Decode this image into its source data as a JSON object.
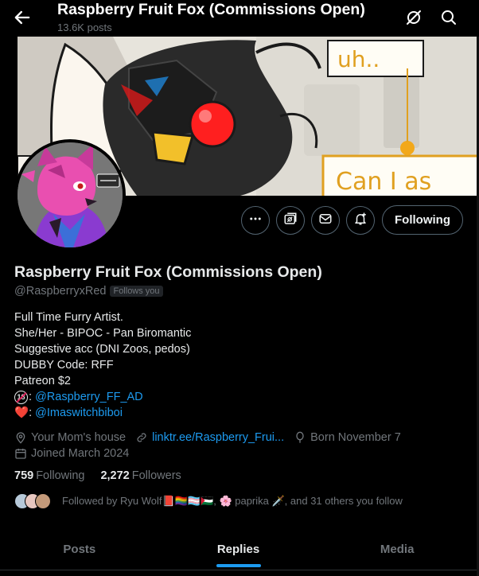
{
  "header": {
    "title": "Raspberry Fruit Fox (Commissions Open)",
    "post_count": "13.6K posts",
    "back_icon": "arrow-left-icon",
    "icons": [
      "grok-icon",
      "search-icon"
    ]
  },
  "banner": {
    "bubble_1": "uh..",
    "bubble_2": "Can I as"
  },
  "actions": {
    "icons": [
      "more-icon",
      "grok-profile-icon",
      "message-icon",
      "notifications-icon"
    ],
    "follow_label": "Following"
  },
  "profile": {
    "name": "Raspberry Fruit Fox (Commissions Open)",
    "handle": "@RaspberryxRed",
    "follows_you": "Follows you",
    "bio": {
      "line1": "Full Time Furry Artist.",
      "line2": "She/Her - BIPOC - Pan Biromantic",
      "line3": "Suggestive acc (DNI Zoos, pedos)",
      "line4": "DUBBY Code: RFF",
      "line5": "Patreon $2",
      "badge18": "18",
      "line6_sep": ": ",
      "line6_link": "@Raspberry_FF_AD",
      "line7_emoji": "❤️",
      "line7_sep": ": ",
      "line7_link": "@Imaswitchbiboi"
    },
    "location": "Your Mom's house",
    "website": "linktr.ee/Raspberry_Frui...",
    "birthday": "Born November 7",
    "joined": "Joined March 2024",
    "following_count": "759",
    "following_label": "Following",
    "followers_count": "2,272",
    "followers_label": "Followers",
    "followed_by": "Followed by Ryu Wolf📕🏳️‍🌈🏳️‍⚧️🇵🇸, 🌸 paprika 🗡️, and 31 others you follow"
  },
  "tabs": [
    {
      "label": "Posts"
    },
    {
      "label": "Replies"
    },
    {
      "label": "Media"
    }
  ],
  "active_tab": "Replies",
  "colors": {
    "background": "#000000",
    "link": "#1d9bf0",
    "muted": "#71767b",
    "border": "#536471"
  }
}
